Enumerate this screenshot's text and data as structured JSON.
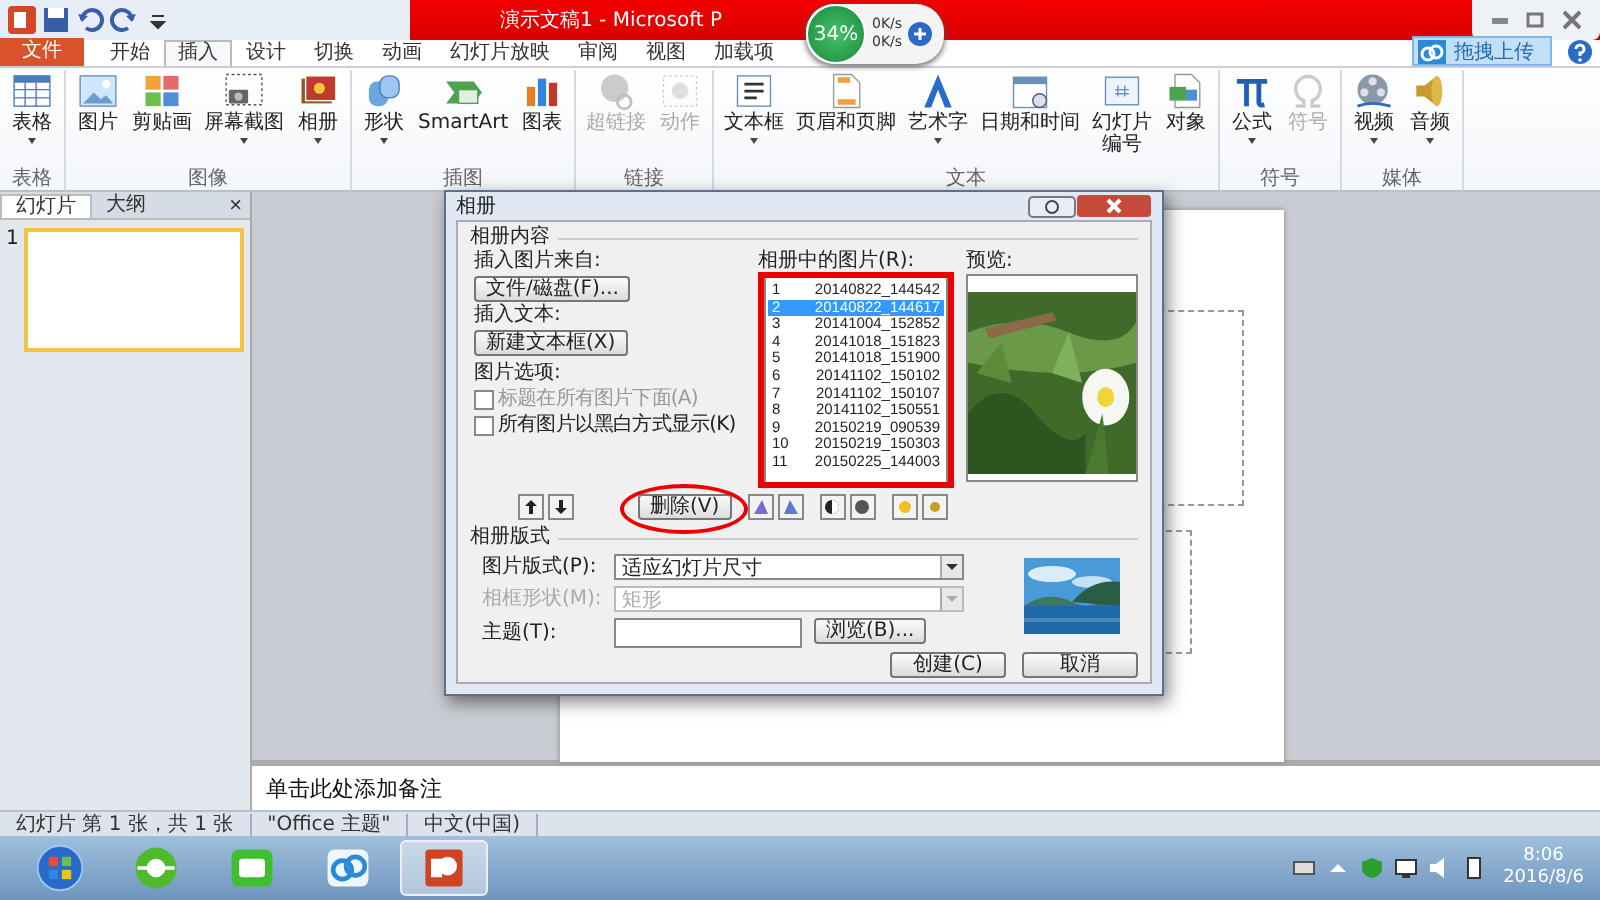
{
  "window": {
    "title": "演示文稿1 - Microsoft P"
  },
  "speed_widget": {
    "percent": "34%",
    "upload": "0K/s",
    "download": "0K/s"
  },
  "tabs": [
    {
      "label": "文件",
      "kind": "file",
      "selected": false
    },
    {
      "label": "开始",
      "kind": "tab",
      "selected": false
    },
    {
      "label": "插入",
      "kind": "tab",
      "selected": true
    },
    {
      "label": "设计",
      "kind": "tab",
      "selected": false
    },
    {
      "label": "切换",
      "kind": "tab",
      "selected": false
    },
    {
      "label": "动画",
      "kind": "tab",
      "selected": false
    },
    {
      "label": "幻灯片放映",
      "kind": "tab",
      "selected": false
    },
    {
      "label": "审阅",
      "kind": "tab",
      "selected": false
    },
    {
      "label": "视图",
      "kind": "tab",
      "selected": false
    },
    {
      "label": "加载项",
      "kind": "tab",
      "selected": false
    }
  ],
  "upload_button": {
    "label": "拖拽上传"
  },
  "ribbon": {
    "groups": [
      {
        "label": "表格",
        "buttons": [
          {
            "label": "表格",
            "dropdown": true,
            "disabled": false
          }
        ]
      },
      {
        "label": "图像",
        "buttons": [
          {
            "label": "图片",
            "dropdown": false,
            "disabled": false
          },
          {
            "label": "剪贴画",
            "dropdown": false,
            "disabled": false
          },
          {
            "label": "屏幕截图",
            "dropdown": true,
            "disabled": false
          },
          {
            "label": "相册",
            "dropdown": true,
            "disabled": false
          }
        ]
      },
      {
        "label": "插图",
        "buttons": [
          {
            "label": "形状",
            "dropdown": true,
            "disabled": false
          },
          {
            "label": "SmartArt",
            "dropdown": false,
            "disabled": false
          },
          {
            "label": "图表",
            "dropdown": false,
            "disabled": false
          }
        ]
      },
      {
        "label": "链接",
        "buttons": [
          {
            "label": "超链接",
            "dropdown": false,
            "disabled": true
          },
          {
            "label": "动作",
            "dropdown": false,
            "disabled": true
          }
        ]
      },
      {
        "label": "文本",
        "buttons": [
          {
            "label": "文本框",
            "dropdown": true,
            "disabled": false
          },
          {
            "label": "页眉和页脚",
            "dropdown": false,
            "disabled": false
          },
          {
            "label": "艺术字",
            "dropdown": true,
            "disabled": false
          },
          {
            "label": "日期和时间",
            "dropdown": false,
            "disabled": false
          },
          {
            "label": "幻灯片编号",
            "dropdown": false,
            "disabled": false
          },
          {
            "label": "对象",
            "dropdown": false,
            "disabled": false
          }
        ]
      },
      {
        "label": "符号",
        "buttons": [
          {
            "label": "公式",
            "dropdown": true,
            "disabled": false
          },
          {
            "label": "符号",
            "dropdown": false,
            "disabled": true
          }
        ]
      },
      {
        "label": "媒体",
        "buttons": [
          {
            "label": "视频",
            "dropdown": true,
            "disabled": false
          },
          {
            "label": "音频",
            "dropdown": true,
            "disabled": false
          }
        ]
      }
    ]
  },
  "slide_pane": {
    "tabs": [
      {
        "label": "幻灯片",
        "selected": true
      },
      {
        "label": "大纲",
        "selected": false
      }
    ],
    "close": "×",
    "slides": [
      {
        "number": "1",
        "selected": true
      }
    ]
  },
  "dialog": {
    "title": "相册",
    "content_section": "相册内容",
    "insert_from_label": "插入图片来自:",
    "file_button": "文件/磁盘(F)...",
    "insert_text_label": "插入文本:",
    "new_textbox_button": "新建文本框(X)",
    "options_label": "图片选项:",
    "options": [
      {
        "label": "标题在所有图片下面(A)",
        "checked": false,
        "disabled": true
      },
      {
        "label": "所有图片以黑白方式显示(K)",
        "checked": false,
        "disabled": false
      }
    ],
    "list_label": "相册中的图片(R):",
    "pictures": [
      {
        "number": "1",
        "name": "20140822_144542",
        "selected": false
      },
      {
        "number": "2",
        "name": "20140822_144617",
        "selected": true
      },
      {
        "number": "3",
        "name": "20141004_152852",
        "selected": false
      },
      {
        "number": "4",
        "name": "20141018_151823",
        "selected": false
      },
      {
        "number": "5",
        "name": "20141018_151900",
        "selected": false
      },
      {
        "number": "6",
        "name": "20141102_150102",
        "selected": false
      },
      {
        "number": "7",
        "name": "20141102_150107",
        "selected": false
      },
      {
        "number": "8",
        "name": "20141102_150551",
        "selected": false
      },
      {
        "number": "9",
        "name": "20150219_090539",
        "selected": false
      },
      {
        "number": "10",
        "name": "20150219_150303",
        "selected": false
      },
      {
        "number": "11",
        "name": "20150225_144003",
        "selected": false
      }
    ],
    "preview_label": "预览:",
    "delete_button": "删除(V)",
    "layout_section": "相册版式",
    "layout_fields": [
      {
        "label": "图片版式(P):",
        "value": "适应幻灯片尺寸",
        "disabled": false
      },
      {
        "label": "相框形状(M):",
        "value": "矩形",
        "disabled": true
      }
    ],
    "theme": {
      "label": "主题(T):",
      "browse_button": "浏览(B)..."
    },
    "buttons": [
      "创建(C)",
      "取消"
    ]
  },
  "notes": {
    "placeholder": "单击此处添加备注"
  },
  "status_bar": {
    "items": [
      "幻灯片 第 1 张，共 1 张",
      "\"Office 主题\"",
      "中文(中国)"
    ]
  },
  "taskbar": {
    "apps": [
      {
        "selected": false
      },
      {
        "selected": false
      },
      {
        "selected": false
      },
      {
        "selected": false
      },
      {
        "selected": true
      }
    ],
    "time": "8:06",
    "date": "2016/8/6"
  }
}
